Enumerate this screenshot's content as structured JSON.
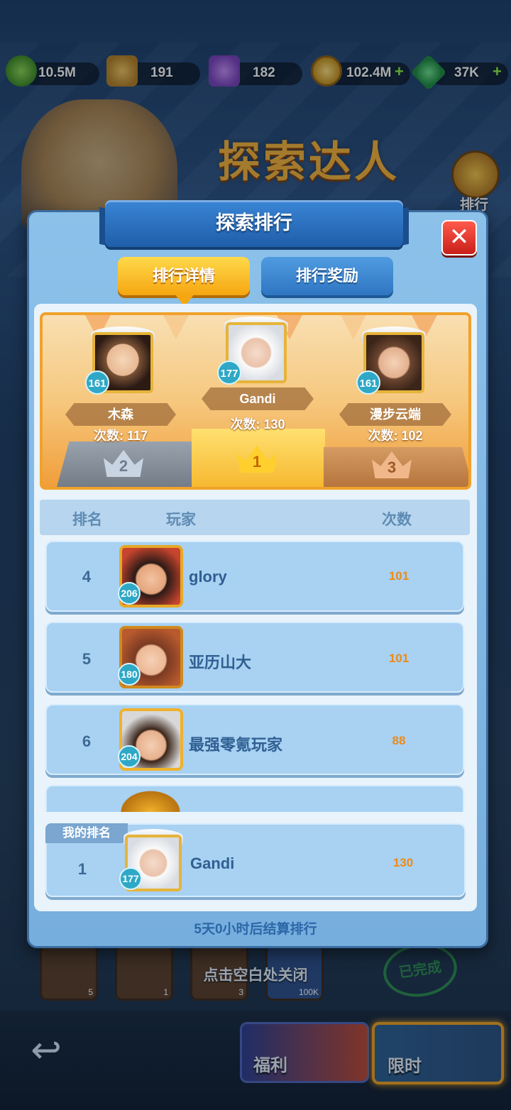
{
  "currencies": [
    {
      "icon": "green-gem-icon",
      "value": "10.5M",
      "has_plus": false
    },
    {
      "icon": "scroll-icon",
      "value": "191",
      "has_plus": false
    },
    {
      "icon": "magic-scroll-icon",
      "value": "182",
      "has_plus": false
    },
    {
      "icon": "gold-coin-icon",
      "value": "102.4M",
      "has_plus": true
    },
    {
      "icon": "emerald-icon",
      "value": "37K",
      "has_plus": true
    }
  ],
  "background": {
    "event_title": "探索达人",
    "side_button_label": "排行",
    "close_hint": "点击空白处关闭",
    "completed_stamp": "已完成",
    "tile_counts": [
      "5",
      "1",
      "3",
      "100K"
    ],
    "welfare_label": "福利",
    "limited_label": "限时"
  },
  "dialog": {
    "title": "探索排行",
    "tabs": [
      {
        "label": "排行详情",
        "active": true
      },
      {
        "label": "排行奖励",
        "active": false
      }
    ],
    "podium": [
      {
        "place": "1",
        "name": "Gandi",
        "level": "177",
        "count": "次数: 130"
      },
      {
        "place": "2",
        "name": "木森",
        "level": "161",
        "count": "次数: 117"
      },
      {
        "place": "3",
        "name": "漫步云端",
        "level": "161",
        "count": "次数: 102"
      }
    ],
    "list_headers": {
      "rank": "排名",
      "player": "玩家",
      "count": "次数"
    },
    "rows": [
      {
        "rank": "4",
        "name": "glory",
        "level": "206",
        "count": "101"
      },
      {
        "rank": "5",
        "name": "亚历山大",
        "level": "180",
        "count": "101"
      },
      {
        "rank": "6",
        "name": "最强零氪玩家",
        "level": "204",
        "count": "88"
      }
    ],
    "my_rank": {
      "tag": "我的排名",
      "rank": "1",
      "name": "Gandi",
      "level": "177",
      "count": "130"
    },
    "footer": "5天0小时后结算排行"
  },
  "colors": {
    "accent_gold": "#f5a611",
    "panel_blue": "#8cc1ea",
    "count_orange": "#ee8a17"
  }
}
